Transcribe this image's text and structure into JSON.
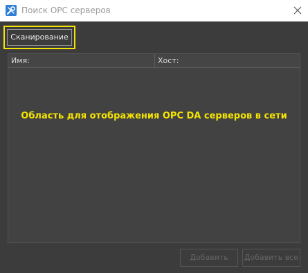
{
  "window": {
    "title": "Поиск OPC серверов",
    "icon": "tools-icon"
  },
  "toolbar": {
    "scan_label": "Сканирование"
  },
  "list": {
    "columns": [
      "Имя:",
      "Хост:"
    ],
    "rows": [],
    "annotation": "Область для отображения OPC DA серверов в сети"
  },
  "footer": {
    "add_label": "Добавить",
    "add_all_label": "Добавить все"
  },
  "colors": {
    "window_bg": "#3c3c3c",
    "highlight": "#f4e400",
    "accent_icon": "#2f7fd6"
  }
}
